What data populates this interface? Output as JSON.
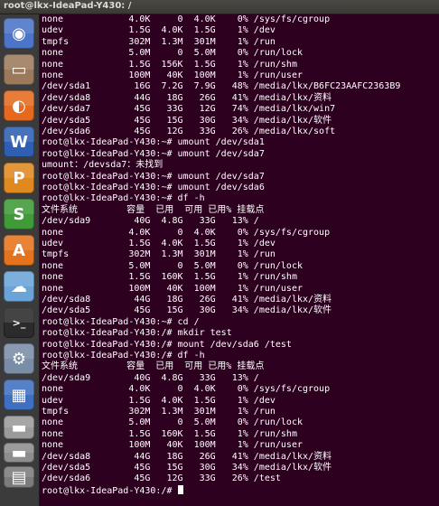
{
  "window": {
    "title": "root@lkx-IdeaPad-Y430: /"
  },
  "launcher": {
    "items": [
      {
        "name": "ubuntu-dash-icon",
        "glyph": "◉",
        "color": "#4c74c9"
      },
      {
        "name": "files-icon",
        "glyph": "▭",
        "color": "#9b7a5c"
      },
      {
        "name": "firefox-icon",
        "glyph": "◐",
        "color": "#e56a1f"
      },
      {
        "name": "wps-writer-icon",
        "glyph": "W",
        "color": "#2e5fb3"
      },
      {
        "name": "wps-presentation-icon",
        "glyph": "P",
        "color": "#e0891f"
      },
      {
        "name": "wps-spreadsheets-icon",
        "glyph": "S",
        "color": "#3f9a37"
      },
      {
        "name": "software-center-icon",
        "glyph": "A",
        "color": "#e4731c"
      },
      {
        "name": "ubuntu-one-icon",
        "glyph": "☁",
        "color": "#6aa4d8"
      },
      {
        "name": "terminal-icon",
        "glyph": ">_",
        "color": "#2b2b2b"
      },
      {
        "name": "system-settings-icon",
        "glyph": "⚙",
        "color": "#7a8da6"
      },
      {
        "name": "workspace-switcher-icon",
        "glyph": "▦",
        "color": "#3f6fc0"
      },
      {
        "name": "drive-icon",
        "glyph": "▬",
        "color": "#9a9a9a"
      },
      {
        "name": "drive-icon-2",
        "glyph": "▬",
        "color": "#8e8e8e"
      },
      {
        "name": "trash-icon",
        "glyph": "▤",
        "color": "#7c7c7c"
      }
    ]
  },
  "terminal": {
    "lines": [
      "none            4.0K     0  4.0K    0% /sys/fs/cgroup",
      "udev            1.5G  4.0K  1.5G    1% /dev",
      "tmpfs           302M  1.3M  301M    1% /run",
      "none            5.0M     0  5.0M    0% /run/lock",
      "none            1.5G  156K  1.5G    1% /run/shm",
      "none            100M   40K  100M    1% /run/user",
      "/dev/sda1        16G  7.2G  7.9G   48% /media/lkx/B6FC23AAFC2363B9",
      "/dev/sda8        44G   18G   26G   41% /media/lkx/资料",
      "/dev/sda7        45G   33G   12G   74% /media/lkx/win7",
      "/dev/sda5        45G   15G   30G   34% /media/lkx/软件",
      "/dev/sda6        45G   12G   33G   26% /media/lkx/soft",
      "root@lkx-IdeaPad-Y430:~# umount /dev/sda1",
      "root@lkx-IdeaPad-Y430:~# umount /dev/sda7",
      "umount：/devsda7：未找到",
      "root@lkx-IdeaPad-Y430:~# umount /dev/sda7",
      "root@lkx-IdeaPad-Y430:~# umount /dev/sda6",
      "root@lkx-IdeaPad-Y430:~# df -h",
      "文件系统         容量  已用  可用 已用% 挂载点",
      "/dev/sda9        40G  4.8G   33G   13% /",
      "none            4.0K     0  4.0K    0% /sys/fs/cgroup",
      "udev            1.5G  4.0K  1.5G    1% /dev",
      "tmpfs           302M  1.3M  301M    1% /run",
      "none            5.0M     0  5.0M    0% /run/lock",
      "none            1.5G  160K  1.5G    1% /run/shm",
      "none            100M   40K  100M    1% /run/user",
      "/dev/sda8        44G   18G   26G   41% /media/lkx/资料",
      "/dev/sda5        45G   15G   30G   34% /media/lkx/软件",
      "root@lkx-IdeaPad-Y430:~# cd /",
      "root@lkx-IdeaPad-Y430:/# mkdir test",
      "root@lkx-IdeaPad-Y430:/# mount /dev/sda6 /test",
      "root@lkx-IdeaPad-Y430:/# df -h",
      "文件系统         容量  已用  可用 已用% 挂载点",
      "/dev/sda9        40G  4.8G   33G   13% /",
      "none            4.0K     0  4.0K    0% /sys/fs/cgroup",
      "udev            1.5G  4.0K  1.5G    1% /dev",
      "tmpfs           302M  1.3M  301M    1% /run",
      "none            5.0M     0  5.0M    0% /run/lock",
      "none            1.5G  160K  1.5G    1% /run/shm",
      "none            100M   40K  100M    1% /run/user",
      "/dev/sda8        44G   18G   26G   41% /media/lkx/资料",
      "/dev/sda5        45G   15G   30G   34% /media/lkx/软件",
      "/dev/sda6        45G   12G   33G   26% /test",
      "root@lkx-IdeaPad-Y430:/# "
    ]
  }
}
